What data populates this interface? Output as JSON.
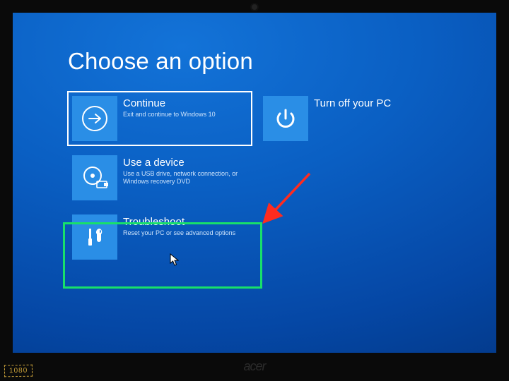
{
  "page": {
    "title": "Choose an option"
  },
  "tiles": {
    "continue": {
      "label": "Continue",
      "desc": "Exit and continue to Windows 10"
    },
    "turnoff": {
      "label": "Turn off your PC",
      "desc": ""
    },
    "device": {
      "label": "Use a device",
      "desc": "Use a USB drive, network connection, or Windows recovery DVD"
    },
    "troubleshoot": {
      "label": "Troubleshoot",
      "desc": "Reset your PC or see advanced options"
    }
  },
  "bezel": {
    "badge": "1080",
    "logo": "acer"
  }
}
